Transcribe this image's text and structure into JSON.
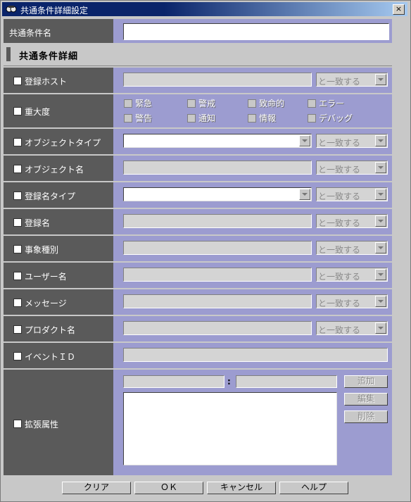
{
  "window": {
    "title": "共通条件詳細設定",
    "close_label": "×"
  },
  "common_condition_name": {
    "label": "共通条件名",
    "value": ""
  },
  "section_title": "共通条件詳細",
  "match_text": "と一致する",
  "rows": {
    "registered_host": {
      "label": "登録ホスト",
      "value": "",
      "match": "と一致する"
    },
    "severity": {
      "label": "重大度",
      "options": [
        "緊急",
        "警戒",
        "致命的",
        "エラー",
        "警告",
        "通知",
        "情報",
        "デバッグ"
      ]
    },
    "object_type": {
      "label": "オブジェクトタイプ",
      "value": "",
      "match": "と一致する"
    },
    "object_name": {
      "label": "オブジェクト名",
      "value": "",
      "match": "と一致する"
    },
    "registered_name_type": {
      "label": "登録名タイプ",
      "value": "",
      "match": "と一致する"
    },
    "registered_name": {
      "label": "登録名",
      "value": "",
      "match": "と一致する"
    },
    "event_category": {
      "label": "事象種別",
      "value": "",
      "match": "と一致する"
    },
    "user_name": {
      "label": "ユーザー名",
      "value": "",
      "match": "と一致する"
    },
    "message": {
      "label": "メッセージ",
      "value": "",
      "match": "と一致する"
    },
    "product_name": {
      "label": "プロダクト名",
      "value": "",
      "match": "と一致する"
    },
    "event_id": {
      "label": "イベントＩＤ",
      "value": ""
    },
    "extended_attr": {
      "label": "拡張属性",
      "separator": ":",
      "add_label": "追加",
      "edit_label": "編集",
      "delete_label": "削除"
    }
  },
  "footer": {
    "clear_label": "クリア",
    "ok_label": "ＯＫ",
    "cancel_label": "キャンセル",
    "help_label": "ヘルプ"
  }
}
